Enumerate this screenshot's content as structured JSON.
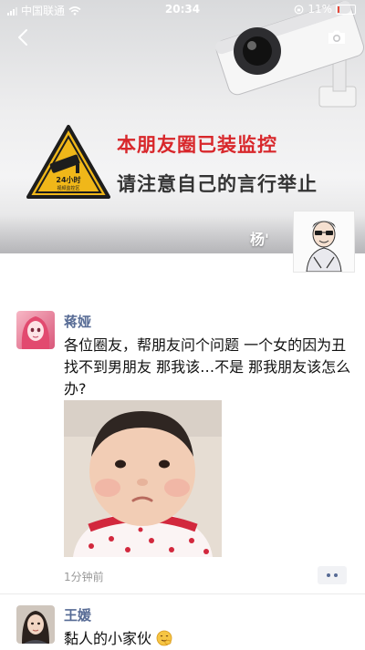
{
  "status_bar": {
    "carrier": "中国联通",
    "time": "20:34",
    "battery": "11%",
    "battery_level": 0.11
  },
  "cover": {
    "sign_text_line1": "24小时",
    "sign_text_line2": "视频监控区",
    "title": "本朋友圈已装监控",
    "subtitle": "请注意自己的言行举止",
    "owner_name": "杨'"
  },
  "posts": [
    {
      "name": "蒋娅",
      "text": "各位圈友，帮朋友问个问题 一个女的因为丑 找不到男朋友 那我该…不是 那我朋友该怎么办?",
      "time": "1分钟前"
    },
    {
      "name": "王媛",
      "text": "黏人的小家伙"
    }
  ],
  "colors": {
    "name_link": "#576b95",
    "cover_title": "#d8272b",
    "battery_low": "#e5493a"
  }
}
